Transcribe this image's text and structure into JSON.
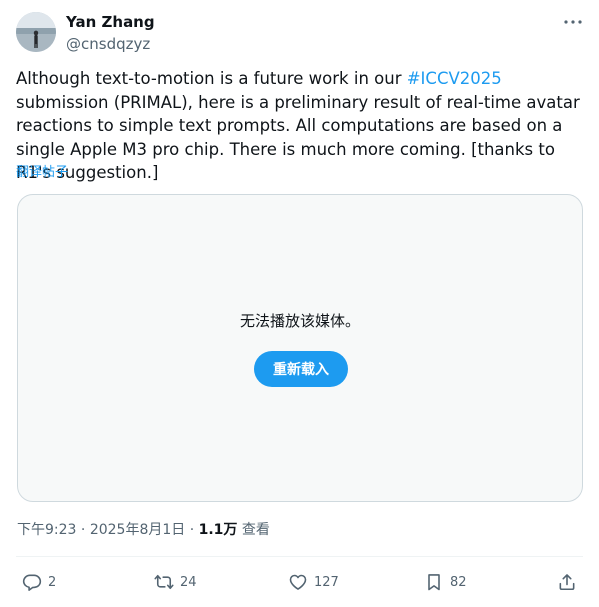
{
  "author": {
    "display_name": "Yan Zhang",
    "handle": "@cnsdqzyz",
    "avatar_icon": "avatar-photo"
  },
  "tweet": {
    "text_before": "Although text-to-motion is a future work in our ",
    "hashtag": "#ICCV2025",
    "text_after": " submission (PRIMAL), here is a preliminary result of real-time avatar reactions to simple text prompts. All computations are based on a single Apple M3 pro chip. There is much more coming. [thanks to R1's suggestion.]",
    "translate_label": "翻译帖子"
  },
  "media": {
    "error_text": "无法播放该媒体。",
    "reload_label": "重新载入"
  },
  "meta": {
    "time": "下午9:23",
    "separator": "·",
    "date": "2025年8月1日",
    "views_count": "1.1万",
    "views_label": "查看"
  },
  "actions": {
    "replies": "2",
    "retweets": "24",
    "likes": "127",
    "bookmarks": "82"
  },
  "colors": {
    "accent": "#1d9bf0",
    "text": "#0f1419",
    "secondary": "#536471",
    "border": "#cfd9de"
  }
}
